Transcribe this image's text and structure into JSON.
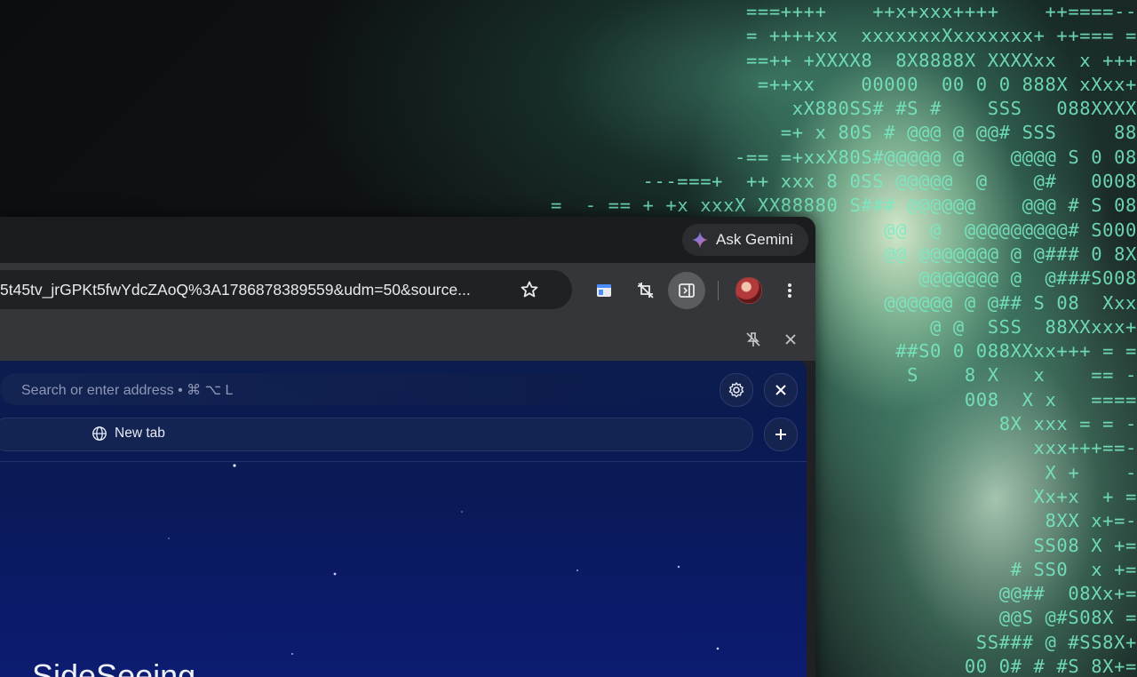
{
  "wallpaper": {
    "ascii_lines": [
      "===++++    ++x+xxx++++    ++====--",
      "= ++++xx  xxxxxxxXxxxxxxx+ ++=== =",
      "==++ +XXXX8  8X8888X XXXXxx  x +++",
      "=++xx    00000  00 0 0 888X xXxx+",
      "xX880SS# #S #    SSS   088XXXX",
      "=+ x 80S # @@@ @ @@# SSS     88",
      "-== =+xxX80S#@@@@@ @    @@@@ S 0 08",
      "---===+  ++ xxx 8 0SS @@@@@  @    @#   0008",
      "=  - == + +x xxxX XX88880 S### @@@@@@    @@@ # S 08",
      "@@  @  @@@@@@@@@# S000",
      "@@ @@@@@@@ @ @### 0 8X",
      "@@@@@@@ @  @###S008",
      "@@@@@@ @ @## S 08  Xxx",
      "@ @  SSS  88XXxxx+",
      "##S0 0 088XXxx+++ = =",
      "S    8 X   x    == -",
      "008  X x   ====",
      "8X xxx = = -",
      "xxx+++==-",
      "X +    -",
      "Xx+x  + =",
      "8XX x+=-",
      "SS08 X +=",
      "# SS0  x +=",
      "@@##  08Xx+=",
      " @@S @#S08X =",
      "SS### @ #SS8X+",
      "00 0# # #S 8X+="
    ]
  },
  "tabstrip": {
    "ask_gemini_label": "Ask Gemini"
  },
  "toolbar": {
    "omnibox_text": "5t45tv_jrGPKt5fwYdcZAoQ%3A1786878389559&udm=50&source...",
    "icons": [
      "bookmark-star-icon",
      "extension-icon",
      "screenshot-icon",
      "side-panel-icon",
      "profile-avatar",
      "more-menu-icon"
    ]
  },
  "side_panel": {
    "search_placeholder": "Search or enter address • ⌘ ⌥ L",
    "new_tab_label": "New tab",
    "title_partial": "SideSeeing"
  },
  "colors": {
    "panel_bg": "#0b1a5e",
    "toolbar_bg": "#35363a",
    "ascii_green": "#78ebc3"
  }
}
